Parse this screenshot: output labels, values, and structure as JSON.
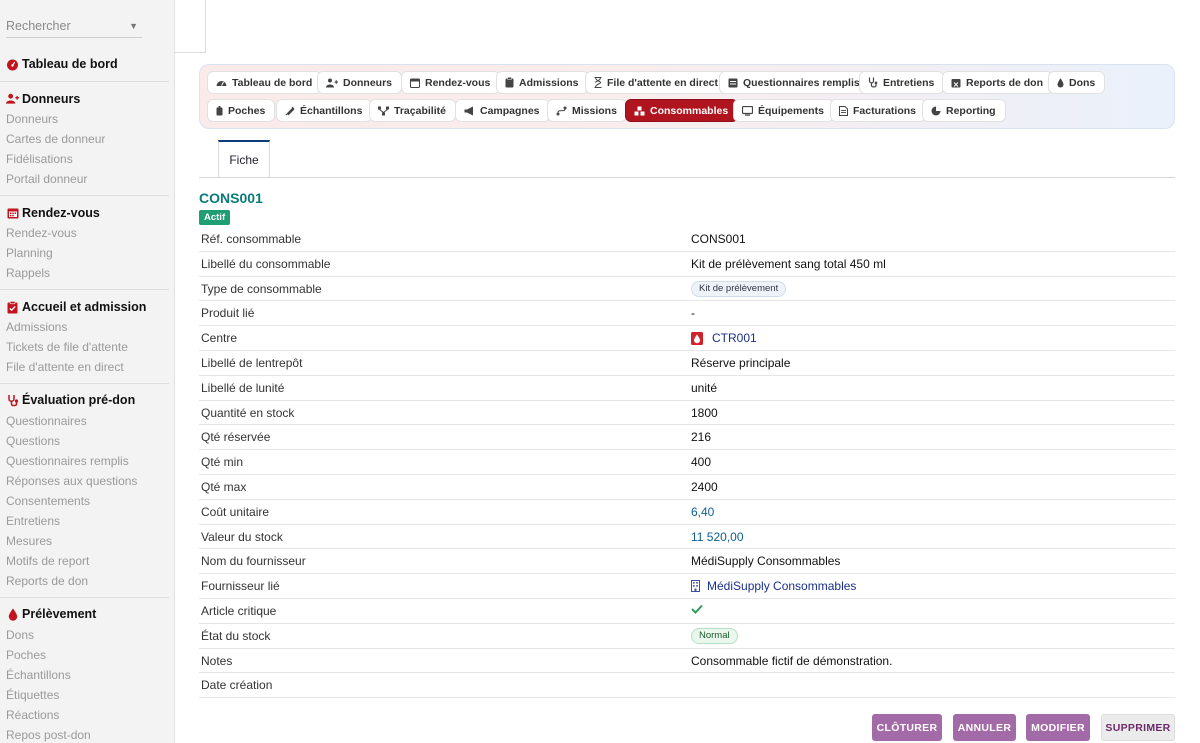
{
  "sidebar": {
    "search_placeholder": "Rechercher",
    "dashboard": "Tableau de bord",
    "sections": [
      {
        "title": "Donneurs",
        "icon": "user-plus-icon",
        "items": [
          "Donneurs",
          "Cartes de donneur",
          "Fidélisations",
          "Portail donneur"
        ]
      },
      {
        "title": "Rendez-vous",
        "icon": "calendar-icon",
        "items": [
          "Rendez-vous",
          "Planning",
          "Rappels"
        ]
      },
      {
        "title": "Accueil et admission",
        "icon": "clipboard-icon",
        "items": [
          "Admissions",
          "Tickets de file d'attente",
          "File d'attente en direct"
        ]
      },
      {
        "title": "Évaluation pré-don",
        "icon": "stethoscope-icon",
        "items": [
          "Questionnaires",
          "Questions",
          "Questionnaires remplis",
          "Réponses aux questions",
          "Consentements",
          "Entretiens",
          "Mesures",
          "Motifs de report",
          "Reports de don"
        ]
      },
      {
        "title": "Prélèvement",
        "icon": "blood-drop-icon",
        "items": [
          "Dons",
          "Poches",
          "Échantillons",
          "Étiquettes",
          "Réactions",
          "Repos post-don"
        ]
      }
    ]
  },
  "tabs": {
    "row1": [
      "Tableau de bord",
      "Donneurs",
      "Rendez-vous",
      "Admissions",
      "File d'attente en direct",
      "Questionnaires remplis",
      "Entretiens",
      "Reports de don",
      "Dons"
    ],
    "row2": [
      "Poches",
      "Échantillons",
      "Traçabilité",
      "Campagnes",
      "Missions",
      "Consommables",
      "Équipements",
      "Facturations",
      "Reporting"
    ],
    "active": "Consommables"
  },
  "record": {
    "tab_label": "Fiche",
    "title": "CONS001",
    "status": "Actif",
    "fields": [
      {
        "label": "Réf. consommable",
        "value": "CONS001"
      },
      {
        "label": "Libellé du consommable",
        "value": "Kit de prélèvement sang total 450 ml"
      },
      {
        "label": "Type de consommable",
        "value": "Kit de prélèvement"
      },
      {
        "label": "Produit lié",
        "value": "-"
      },
      {
        "label": "Centre",
        "value": "CTR001"
      },
      {
        "label": "Libellé de lentrepôt",
        "value": "Réserve principale"
      },
      {
        "label": "Libellé de lunité",
        "value": "unité"
      },
      {
        "label": "Quantité en stock",
        "value": "1800"
      },
      {
        "label": "Qté réservée",
        "value": "216"
      },
      {
        "label": "Qté min",
        "value": "400"
      },
      {
        "label": "Qté max",
        "value": "2400"
      },
      {
        "label": "Coût unitaire",
        "value": "6,40"
      },
      {
        "label": "Valeur du stock",
        "value": "11 520,00"
      },
      {
        "label": "Nom du fournisseur",
        "value": "MédiSupply Consommables"
      },
      {
        "label": "Fournisseur lié",
        "value": "MédiSupply Consommables"
      },
      {
        "label": "Article critique",
        "value": "✔"
      },
      {
        "label": "État du stock",
        "value": "Normal"
      },
      {
        "label": "Notes",
        "value": "Consommable fictif de démonstration."
      },
      {
        "label": "Date création",
        "value": ""
      }
    ]
  },
  "actions": {
    "close": "CLÔTURER",
    "cancel": "ANNULER",
    "edit": "MODIFIER",
    "delete": "SUPPRIMER"
  },
  "colors": {
    "active_tab": "#b0141e",
    "title": "#0a7a7a",
    "status_green": "#1f9d73",
    "action_purple": "#a26aa6",
    "check_green": "#2e9d58"
  }
}
